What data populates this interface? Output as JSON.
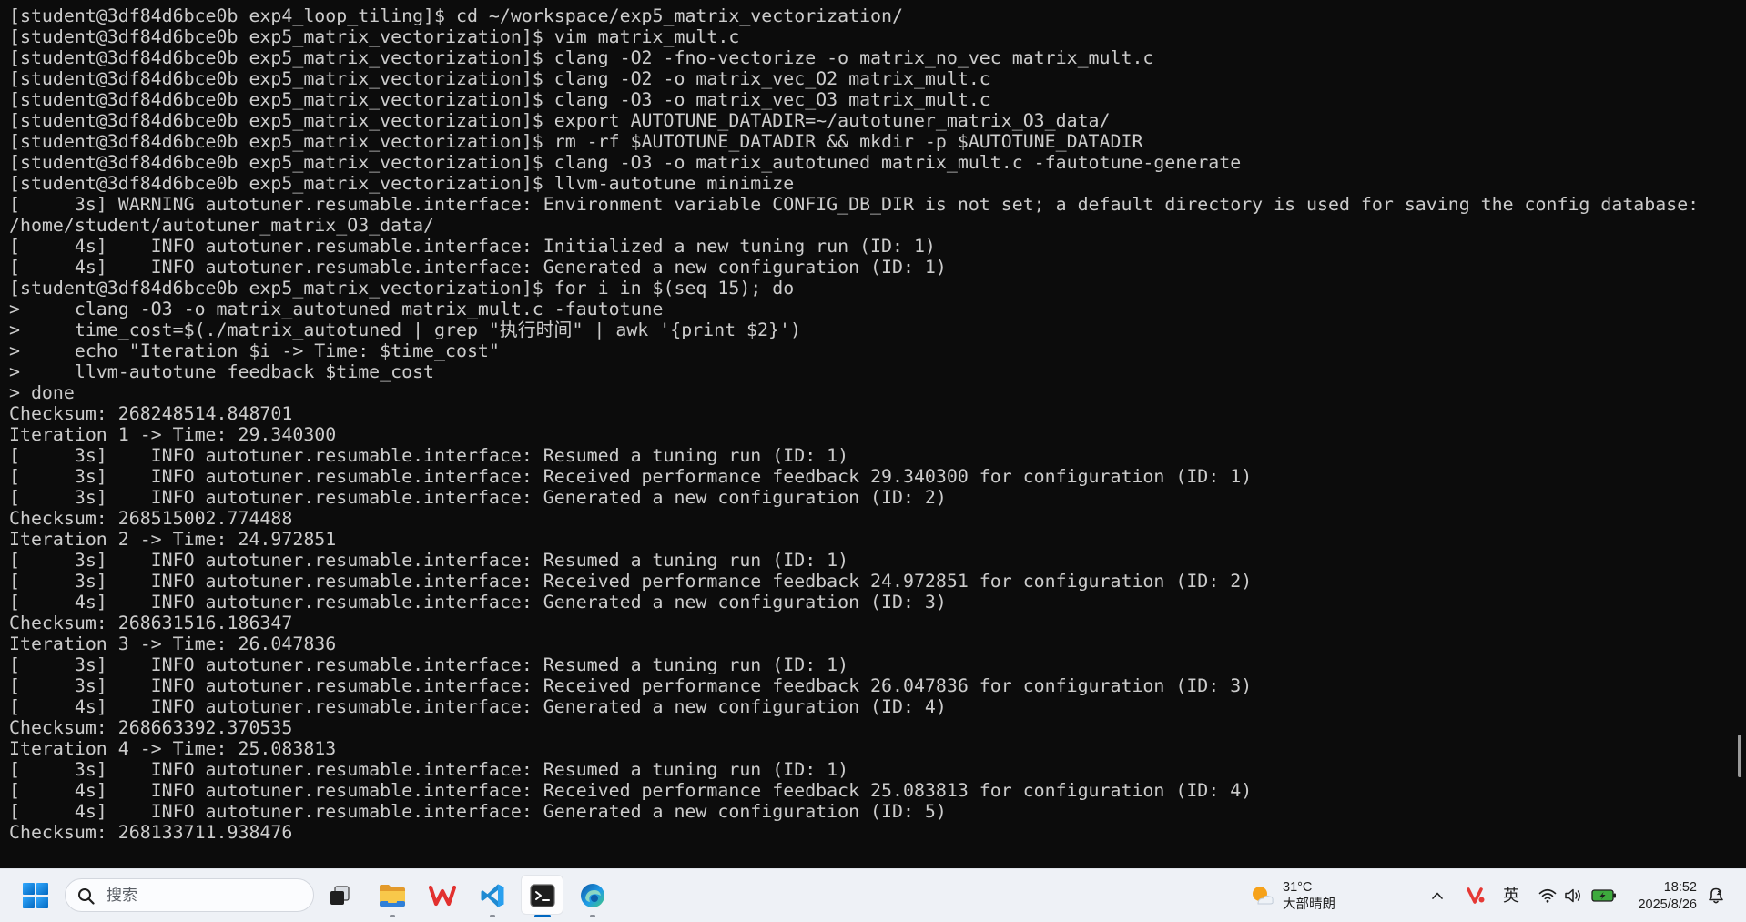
{
  "terminal": {
    "lines": [
      "[student@3df84d6bce0b exp4_loop_tiling]$ cd ~/workspace/exp5_matrix_vectorization/",
      "[student@3df84d6bce0b exp5_matrix_vectorization]$ vim matrix_mult.c",
      "[student@3df84d6bce0b exp5_matrix_vectorization]$ clang -O2 -fno-vectorize -o matrix_no_vec matrix_mult.c",
      "[student@3df84d6bce0b exp5_matrix_vectorization]$ clang -O2 -o matrix_vec_O2 matrix_mult.c",
      "[student@3df84d6bce0b exp5_matrix_vectorization]$ clang -O3 -o matrix_vec_O3 matrix_mult.c",
      "[student@3df84d6bce0b exp5_matrix_vectorization]$ export AUTOTUNE_DATADIR=~/autotuner_matrix_O3_data/",
      "[student@3df84d6bce0b exp5_matrix_vectorization]$ rm -rf $AUTOTUNE_DATADIR && mkdir -p $AUTOTUNE_DATADIR",
      "[student@3df84d6bce0b exp5_matrix_vectorization]$ clang -O3 -o matrix_autotuned matrix_mult.c -fautotune-generate",
      "[student@3df84d6bce0b exp5_matrix_vectorization]$ llvm-autotune minimize",
      "[     3s] WARNING autotuner.resumable.interface: Environment variable CONFIG_DB_DIR is not set; a default directory is used for saving the config database:",
      "/home/student/autotuner_matrix_O3_data/",
      "[     4s]    INFO autotuner.resumable.interface: Initialized a new tuning run (ID: 1)",
      "[     4s]    INFO autotuner.resumable.interface: Generated a new configuration (ID: 1)",
      "[student@3df84d6bce0b exp5_matrix_vectorization]$ for i in $(seq 15); do",
      ">     clang -O3 -o matrix_autotuned matrix_mult.c -fautotune",
      ">     time_cost=$(./matrix_autotuned | grep \"执行时间\" | awk '{print $2}')",
      ">     echo \"Iteration $i -> Time: $time_cost\"",
      ">     llvm-autotune feedback $time_cost",
      "> done",
      "Checksum: 268248514.848701",
      "Iteration 1 -> Time: 29.340300",
      "[     3s]    INFO autotuner.resumable.interface: Resumed a tuning run (ID: 1)",
      "[     3s]    INFO autotuner.resumable.interface: Received performance feedback 29.340300 for configuration (ID: 1)",
      "[     3s]    INFO autotuner.resumable.interface: Generated a new configuration (ID: 2)",
      "Checksum: 268515002.774488",
      "Iteration 2 -> Time: 24.972851",
      "[     3s]    INFO autotuner.resumable.interface: Resumed a tuning run (ID: 1)",
      "[     3s]    INFO autotuner.resumable.interface: Received performance feedback 24.972851 for configuration (ID: 2)",
      "[     4s]    INFO autotuner.resumable.interface: Generated a new configuration (ID: 3)",
      "Checksum: 268631516.186347",
      "Iteration 3 -> Time: 26.047836",
      "[     3s]    INFO autotuner.resumable.interface: Resumed a tuning run (ID: 1)",
      "[     3s]    INFO autotuner.resumable.interface: Received performance feedback 26.047836 for configuration (ID: 3)",
      "[     4s]    INFO autotuner.resumable.interface: Generated a new configuration (ID: 4)",
      "Checksum: 268663392.370535",
      "Iteration 4 -> Time: 25.083813",
      "[     3s]    INFO autotuner.resumable.interface: Resumed a tuning run (ID: 1)",
      "[     4s]    INFO autotuner.resumable.interface: Received performance feedback 25.083813 for configuration (ID: 4)",
      "[     4s]    INFO autotuner.resumable.interface: Generated a new configuration (ID: 5)",
      "Checksum: 268133711.938476"
    ]
  },
  "taskbar": {
    "start_button": {
      "icon": "windows-logo-icon"
    },
    "search": {
      "placeholder": "搜索",
      "icon": "search-icon"
    },
    "pinned_apps": [
      {
        "icon": "task-view-icon",
        "running": false
      },
      {
        "icon": "file-explorer-icon",
        "running": true
      },
      {
        "icon": "wps-office-icon",
        "running": false
      },
      {
        "icon": "vscode-icon",
        "running": true
      },
      {
        "icon": "terminal-icon",
        "running": true,
        "active": true
      },
      {
        "icon": "edge-browser-icon",
        "running": true
      }
    ],
    "weather": {
      "icon": "partly-sunny-icon",
      "temperature": "31°C",
      "condition": "大部晴朗"
    },
    "tray": {
      "icons": [
        "chevron-up-icon",
        "wps-tray-icon",
        "wifi-icon",
        "volume-icon",
        "battery-icon"
      ],
      "input_method": "英"
    },
    "clock": {
      "time": "18:52",
      "date": "2025/8/26"
    },
    "notification_icon": "notification-bell-icon"
  },
  "colors": {
    "terminal_background": "#0c0c0c",
    "terminal_foreground": "#cccccc",
    "taskbar_background": "#eef1f6",
    "accent": "#0067c0"
  }
}
